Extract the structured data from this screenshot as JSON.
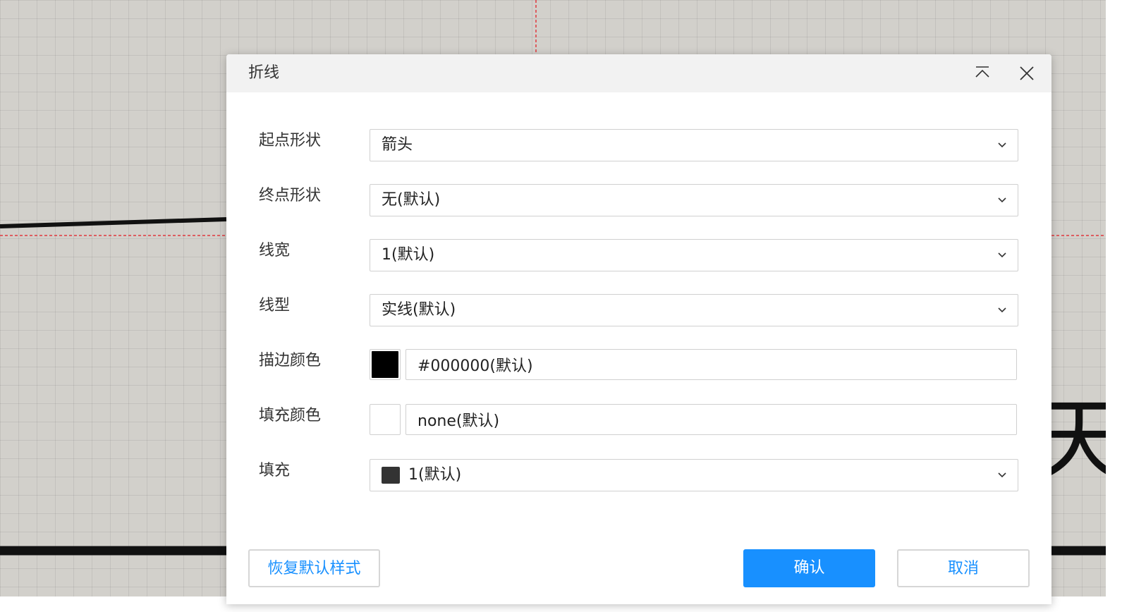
{
  "dialog": {
    "title": "折线",
    "collapse_icon": "chevron-up-icon",
    "close_icon": "close-icon"
  },
  "form": {
    "start_shape": {
      "label": "起点形状",
      "value": "箭头"
    },
    "end_shape": {
      "label": "终点形状",
      "value": "无(默认)"
    },
    "line_width": {
      "label": "线宽",
      "value": "1(默认)"
    },
    "line_type": {
      "label": "线型",
      "value": "实线(默认)"
    },
    "stroke_color": {
      "label": "描边颜色",
      "value": "#000000(默认)",
      "swatch": "#000000"
    },
    "fill_color": {
      "label": "填充颜色",
      "value": "none(默认)",
      "swatch": "#ffffff"
    },
    "fill": {
      "label": "填充",
      "value": "1(默认)",
      "swatch": "#333333"
    }
  },
  "buttons": {
    "reset": "恢复默认样式",
    "confirm": "确认",
    "cancel": "取消"
  },
  "canvas": {
    "glyph": "天"
  },
  "colors": {
    "primary": "#1890ff",
    "header_bg": "#f2f2f2",
    "canvas_bg": "#d2d0cb"
  }
}
